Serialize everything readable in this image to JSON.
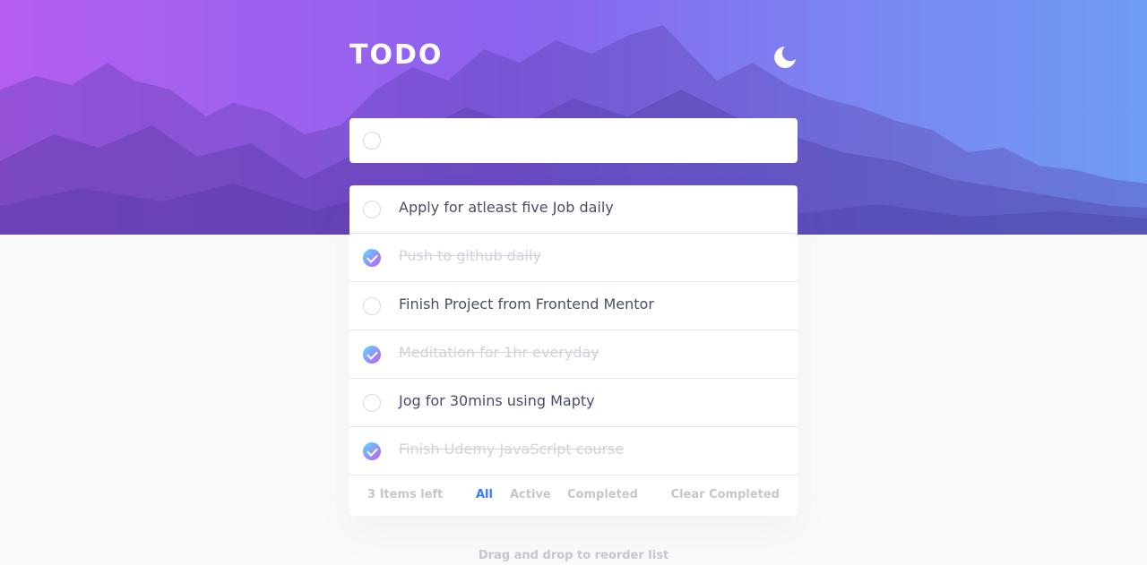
{
  "header": {
    "title": "TODO",
    "theme_icon": "moon-icon"
  },
  "new_todo": {
    "value": "",
    "placeholder": ""
  },
  "todos": [
    {
      "text": "Apply for atleast five Job daily",
      "completed": false
    },
    {
      "text": "Push to github daily",
      "completed": true
    },
    {
      "text": "Finish Project from Frontend Mentor",
      "completed": false
    },
    {
      "text": "Meditation for 1hr everyday",
      "completed": true
    },
    {
      "text": "Jog for 30mins using Mapty",
      "completed": false
    },
    {
      "text": "Finish Udemy JavaScript course",
      "completed": true
    }
  ],
  "footer": {
    "items_left": "3 Items left",
    "filter_all": "All",
    "filter_active": "Active",
    "filter_completed": "Completed",
    "clear_completed": "Clear Completed"
  },
  "hint": "Drag and drop to reorder list",
  "colors": {
    "accent": "#3a7bfd",
    "check_gradient_start": "#57ddff",
    "check_gradient_end": "#c058f3",
    "text": "#494c6b",
    "muted": "#c6c6cf"
  }
}
